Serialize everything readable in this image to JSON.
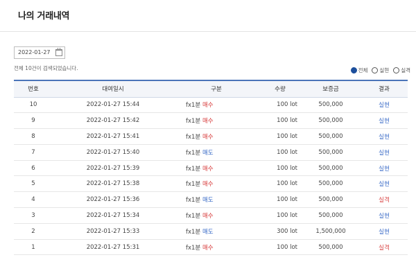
{
  "page": {
    "title": "나의 거래내역"
  },
  "search": {
    "date": "2022-01-27",
    "result_text": "전체 10건이 검색되었습니다."
  },
  "filters": [
    {
      "label": "전체",
      "selected": true
    },
    {
      "label": "실현",
      "selected": false
    },
    {
      "label": "실격",
      "selected": false
    }
  ],
  "table": {
    "headers": {
      "no": "번호",
      "date": "대여일시",
      "type": "구분",
      "qty": "수량",
      "deposit": "보증금",
      "result": "결과"
    },
    "rows": [
      {
        "no": "10",
        "date": "2022-01-27 15:44",
        "product": "fx1분",
        "side": "매수",
        "side_class": "buy",
        "qty": "100 lot",
        "deposit": "500,000",
        "result": "실현",
        "result_class": "win"
      },
      {
        "no": "9",
        "date": "2022-01-27 15:42",
        "product": "fx1분",
        "side": "매수",
        "side_class": "buy",
        "qty": "100 lot",
        "deposit": "500,000",
        "result": "실현",
        "result_class": "win"
      },
      {
        "no": "8",
        "date": "2022-01-27 15:41",
        "product": "fx1분",
        "side": "매수",
        "side_class": "buy",
        "qty": "100 lot",
        "deposit": "500,000",
        "result": "실현",
        "result_class": "win"
      },
      {
        "no": "7",
        "date": "2022-01-27 15:40",
        "product": "fx1분",
        "side": "매도",
        "side_class": "sell",
        "qty": "100 lot",
        "deposit": "500,000",
        "result": "실현",
        "result_class": "win"
      },
      {
        "no": "6",
        "date": "2022-01-27 15:39",
        "product": "fx1분",
        "side": "매수",
        "side_class": "buy",
        "qty": "100 lot",
        "deposit": "500,000",
        "result": "실현",
        "result_class": "win"
      },
      {
        "no": "5",
        "date": "2022-01-27 15:38",
        "product": "fx1분",
        "side": "매수",
        "side_class": "buy",
        "qty": "100 lot",
        "deposit": "500,000",
        "result": "실현",
        "result_class": "win"
      },
      {
        "no": "4",
        "date": "2022-01-27 15:36",
        "product": "fx1분",
        "side": "매도",
        "side_class": "sell",
        "qty": "100 lot",
        "deposit": "500,000",
        "result": "실격",
        "result_class": "loss"
      },
      {
        "no": "3",
        "date": "2022-01-27 15:34",
        "product": "fx1분",
        "side": "매수",
        "side_class": "buy",
        "qty": "100 lot",
        "deposit": "500,000",
        "result": "실현",
        "result_class": "win"
      },
      {
        "no": "2",
        "date": "2022-01-27 15:33",
        "product": "fx1분",
        "side": "매도",
        "side_class": "sell",
        "qty": "300 lot",
        "deposit": "1,500,000",
        "result": "실현",
        "result_class": "win"
      },
      {
        "no": "1",
        "date": "2022-01-27 15:31",
        "product": "fx1분",
        "side": "매수",
        "side_class": "buy",
        "qty": "100 lot",
        "deposit": "500,000",
        "result": "실격",
        "result_class": "loss"
      }
    ]
  },
  "colors": {
    "accent": "#1d4f9c",
    "buy": "#d84040",
    "sell": "#3a6bc7",
    "header_border": "#4a74b8"
  }
}
